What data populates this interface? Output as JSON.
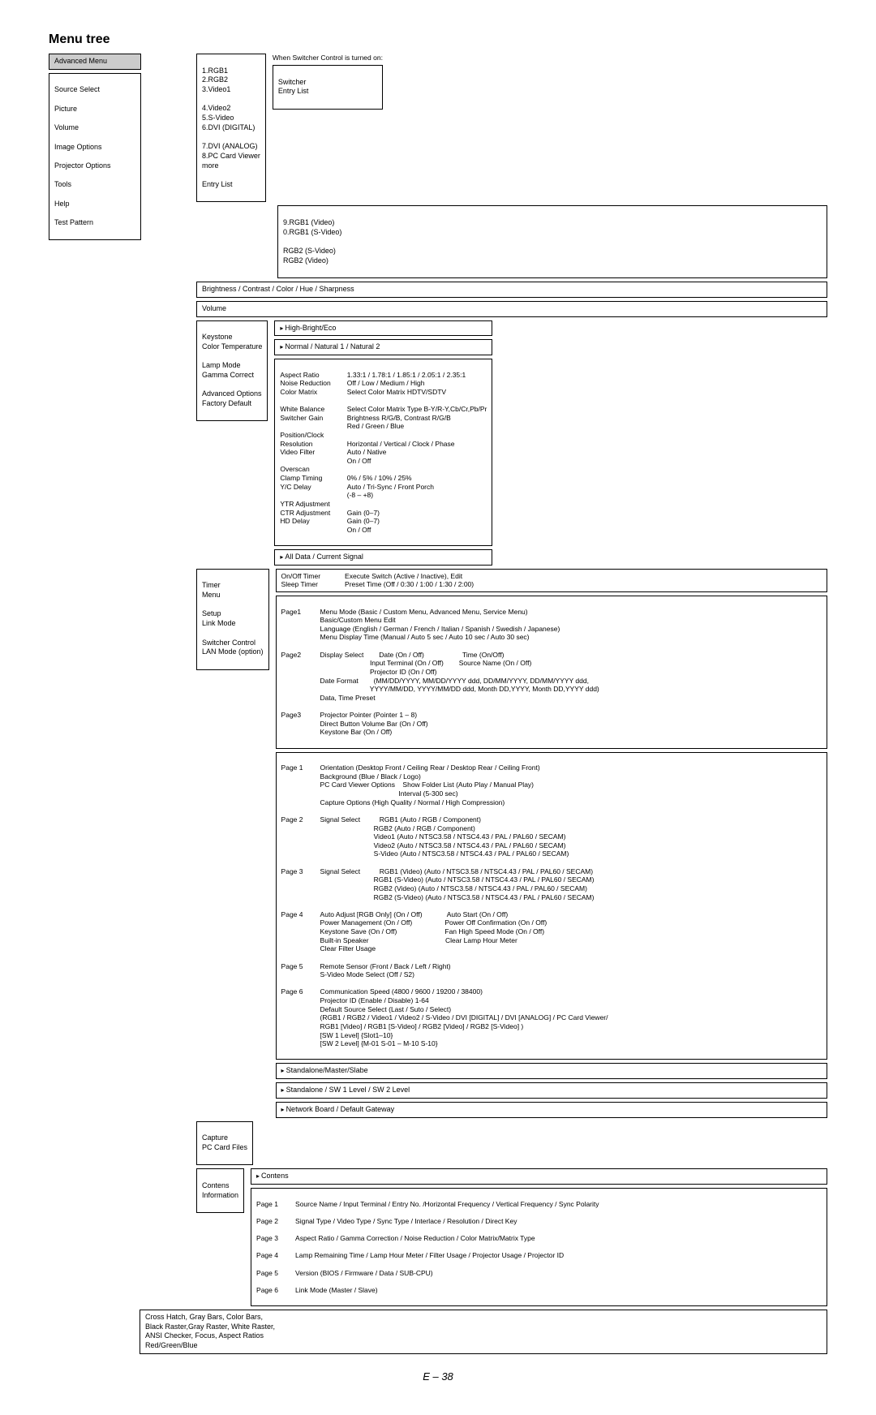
{
  "title": "Menu tree",
  "switcher_note": "When Switcher Control is turned on:",
  "advanced_menu": {
    "label": "Advanced Menu",
    "items": [
      "Source Select",
      "Picture",
      "Volume",
      "Image Options",
      "Projector Options",
      "Tools",
      "Help",
      "Test Pattern"
    ]
  },
  "source_list": [
    "1.RGB1",
    "2.RGB2",
    "3.Video1",
    "4.Video2",
    "5.S-Video",
    "6.DVI (DIGITAL)",
    "7.DVI (ANALOG)",
    "8.PC Card Viewer",
    "more",
    "Entry List"
  ],
  "switcher_box": [
    "Switcher",
    "Entry List"
  ],
  "more_list": [
    "9.RGB1 (Video)",
    "0.RGB1 (S-Video)",
    "RGB2 (S-Video)",
    "RGB2 (Video)"
  ],
  "picture_box": "Brightness / Contrast / Color / Hue / Sharpness",
  "volume_box": "Volume",
  "image_options": [
    "Keystone",
    "Color Temperature",
    "Lamp Mode",
    "Gamma Correct",
    "Advanced Options",
    "Factory Default"
  ],
  "lamp_mode": "High-Bright/Eco",
  "color_temp": "Normal / Natural 1 / Natural 2",
  "adv_opts_left": [
    "Aspect Ratio",
    "Noise Reduction",
    "Color Matrix",
    "",
    "White Balance",
    "Switcher Gain",
    "Position/Clock",
    "Resolution",
    "Video Filter",
    "Overscan",
    "Clamp Timing",
    "Y/C Delay",
    "YTR Adjustment",
    "CTR Adjustment",
    "HD Delay"
  ],
  "adv_opts_right": [
    "1.33:1 / 1.78:1 / 1.85:1 / 2.05:1 / 2.35:1",
    "Off / Low / Medium / High",
    "Select Color Matrix HDTV/SDTV",
    "Select Color Matrix Type B-Y/R-Y,Cb/Cr,Pb/Pr",
    "Brightness R/G/B, Contrast R/G/B",
    "Red / Green / Blue",
    "Horizontal / Vertical / Clock / Phase",
    "Auto / Native",
    "On / Off",
    "0% / 5% / 10% / 25%",
    "Auto / Tri-Sync / Front Porch",
    "(-8 – +8)",
    "Gain (0–7)",
    "Gain (0–7)",
    "On / Off"
  ],
  "factory_default": "All Data / Current Signal",
  "projector_options": [
    "Timer",
    "Menu",
    "Setup",
    "Link Mode",
    "Switcher Control",
    "LAN Mode (option)"
  ],
  "timer_left": [
    "On/Off Timer",
    "Sleep Timer"
  ],
  "timer_right": [
    "Execute Switch (Active / Inactive), Edit",
    "Preset Time (Off / 0:30 / 1:00 / 1:30 / 2:00)"
  ],
  "menu_pages": {
    "page1": [
      "Menu Mode (Basic / Custom Menu, Advanced Menu, Service Menu)",
      "Basic/Custom Menu Edit",
      "Language (English / German / French / Italian / Spanish / Swedish / Japanese)",
      "Menu Display Time (Manual / Auto 5 sec / Auto 10 sec / Auto 30 sec)"
    ],
    "page2": [
      "Display Select        Date (On / Off)                    Time (On/Off)",
      "                          Input Terminal (On / Off)        Source Name (On / Off)",
      "                          Projector ID (On / Off)",
      "Date Format        (MM/DD/YYYY, MM/DD/YYYY ddd, DD/MM/YYYY, DD/MM/YYYY ddd,",
      "                          YYYY/MM/DD, YYYY/MM/DD ddd, Month DD,YYYY, Month DD,YYYY ddd)",
      "Data, Time Preset"
    ],
    "page3": [
      "Projector Pointer (Pointer 1 – 8)",
      "Direct Button Volume Bar (On / Off)",
      "Keystone Bar (On / Off)"
    ]
  },
  "setup_pages": {
    "page1": [
      "Orientation (Desktop Front / Ceiling Rear / Desktop Rear / Ceiling Front)",
      "Background (Blue / Black / Logo)",
      "PC Card Viewer Options    Show Folder List (Auto Play / Manual Play)",
      "                                         Interval (5-300 sec)",
      "Capture Options (High Quality / Normal / High Compression)"
    ],
    "page2": [
      "Signal Select          RGB1 (Auto / RGB / Component)",
      "                            RGB2 (Auto / RGB / Component)",
      "                            Video1 (Auto / NTSC3.58 / NTSC4.43 / PAL / PAL60 / SECAM)",
      "                            Video2 (Auto / NTSC3.58 / NTSC4.43 / PAL / PAL60 / SECAM)",
      "                            S-Video (Auto / NTSC3.58 / NTSC4.43 / PAL / PAL60 / SECAM)"
    ],
    "page3": [
      "Signal Select          RGB1 (Video) (Auto / NTSC3.58 / NTSC4.43 / PAL / PAL60 / SECAM)",
      "                            RGB1 (S-Video) (Auto / NTSC3.58 / NTSC4.43 / PAL / PAL60 / SECAM)",
      "                            RGB2 (Video) (Auto / NTSC3.58 / NTSC4.43 / PAL / PAL60 / SECAM)",
      "                            RGB2 (S-Video) (Auto / NTSC3.58 / NTSC4.43 / PAL / PAL60 / SECAM)"
    ],
    "page4": [
      "Auto Adjust [RGB Only] (On / Off)             Auto Start (On / Off)",
      "Power Management (On / Off)                 Power Off Confirmation (On / Off)",
      "Keystone Save (On / Off)                         Fan High Speed Mode (On / Off)",
      "Built-in Speaker                                        Clear Lamp Hour Meter",
      "Clear Filter Usage"
    ],
    "page5": [
      "Remote Sensor (Front / Back / Left / Right)",
      "S-Video Mode Select (Off / S2)"
    ],
    "page6": [
      "Communication Speed (4800 / 9600 / 19200 / 38400)",
      "Projector ID (Enable / Disable) 1-64",
      "Default Source Select (Last / Suto / Select)",
      "(RGB1 / RGB2 / Video1 / Video2 / S-Video / DVI [DIGITAL] / DVI [ANALOG] / PC Card Viewer/",
      "RGB1 [Video] / RGB1 [S-Video] / RGB2 [Video] / RGB2 [S-Video] )",
      "[SW 1 Level] {Slot1–10}",
      "[SW 2 Level] {M-01 S-01 – M-10 S-10}"
    ]
  },
  "link_mode": "Standalone/Master/Slabe",
  "switcher_control": "Standalone / SW 1 Level / SW 2 Level",
  "lan_mode": "Network Board / Default Gateway",
  "tools": [
    "Capture",
    "PC Card Files"
  ],
  "help": [
    "Contens",
    "Information"
  ],
  "contens_box": "Contens",
  "info_pages": {
    "page1": "Source Name / Input Terminal / Entry No. /Horizontal Frequency / Vertical Frequency / Sync Polarity",
    "page2": "Signal Type / Video Type / Sync Type / Interlace / Resolution / Direct Key",
    "page3": "Aspect Ratio / Gamma Correction / Noise Reduction / Color Matrix/Matrix Type",
    "page4": "Lamp Remaining Time / Lamp Hour Meter / Filter Usage / Projector Usage / Projector ID",
    "page5": "Version (BIOS / Firmware / Data / SUB-CPU)",
    "page6": "Link Mode (Master / Slave)"
  },
  "test_pattern": "Cross Hatch, Gray Bars, Color Bars,\nBlack Raster,Gray Raster, White Raster,\nANSI Checker, Focus, Aspect Ratios\nRed/Green/Blue",
  "page_num": "E – 38",
  "labels": {
    "page1": "Page1",
    "page2": "Page2",
    "page3": "Page3",
    "p1": "Page 1",
    "p2": "Page 2",
    "p3": "Page 3",
    "p4": "Page 4",
    "p5": "Page 5",
    "p6": "Page 6"
  }
}
